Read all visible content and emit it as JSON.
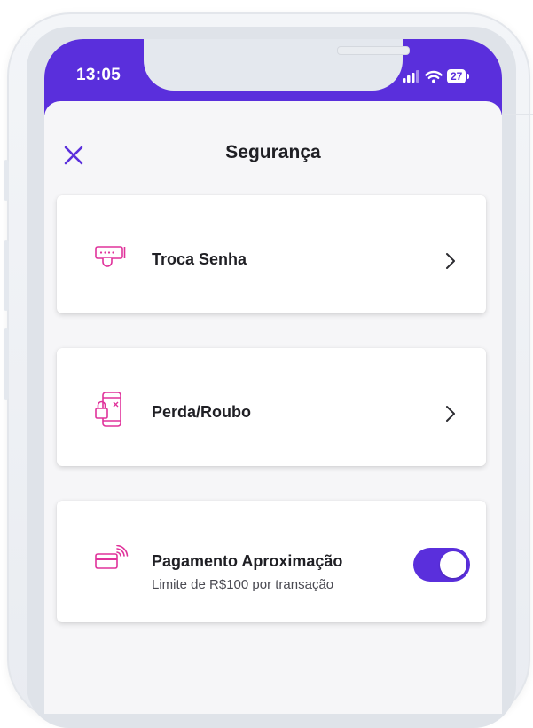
{
  "status_bar": {
    "time": "13:05",
    "battery": "27",
    "color": "#5a2fdc"
  },
  "header": {
    "title": "Segurança",
    "close_icon": "close-icon"
  },
  "accent_color": "#5a2fdc",
  "icon_color": "#e0329b",
  "options": [
    {
      "title": "Troca Senha",
      "icon": "keypad-password-icon",
      "action": "chevron-right-icon"
    },
    {
      "title": "Perda/Roubo",
      "icon": "phone-lock-icon",
      "action": "chevron-right-icon"
    },
    {
      "title": "Pagamento Aproximação",
      "subtitle": "Limite de R$100 por transação",
      "icon": "contactless-card-icon",
      "toggle_on": true
    }
  ]
}
